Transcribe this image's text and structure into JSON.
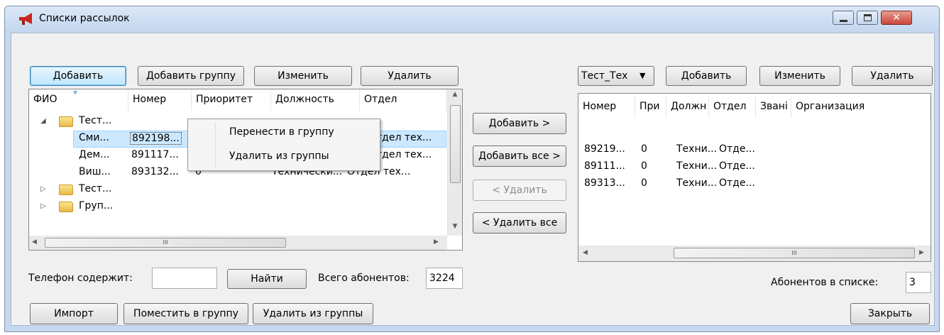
{
  "window": {
    "title": "Списки рассылок"
  },
  "left": {
    "buttons": {
      "add": "Добавить",
      "add_group": "Добавить группу",
      "edit": "Изменить",
      "delete": "Удалить"
    },
    "columns": [
      "ФИО",
      "Номер",
      "Приоритет",
      "Должность",
      "Отдел"
    ],
    "rows": [
      {
        "name": "Тест...",
        "kind": "group"
      },
      {
        "name": "Сми...",
        "number": "892198...",
        "priority": "",
        "position": "",
        "department": "Отдел тех..."
      },
      {
        "name": "Дем...",
        "number": "891117...",
        "priority": "",
        "position": "",
        "department": "Отдел тех..."
      },
      {
        "name": "Виш...",
        "number": "893132...",
        "priority": "0",
        "position": "Технически...",
        "department": "Отдел тех..."
      },
      {
        "name": "Тест...",
        "kind": "group"
      },
      {
        "name": "Груп...",
        "kind": "group"
      }
    ],
    "scroll_glyph": "III"
  },
  "context_menu": {
    "items": [
      "Перенести в группу",
      "Удалить из группы"
    ]
  },
  "middle": {
    "add": "Добавить >",
    "add_all": "Добавить все >",
    "remove": "< Удалить",
    "remove_all": "< Удалить все"
  },
  "right": {
    "list_select": "Тест_Тех",
    "buttons": {
      "add": "Добавить",
      "edit": "Изменить",
      "delete": "Удалить"
    },
    "columns": [
      "Номер",
      "При",
      "Должн",
      "Отдел",
      "Звані",
      "Организация"
    ],
    "rows": [
      {
        "number": "89219...",
        "priority": "0",
        "position": "Техни...",
        "department": "Отде..."
      },
      {
        "number": "89111...",
        "priority": "0",
        "position": "Техни...",
        "department": "Отде..."
      },
      {
        "number": "89313...",
        "priority": "0",
        "position": "Техни...",
        "department": "Отде..."
      }
    ],
    "scroll_glyph": "III"
  },
  "search": {
    "label": "Телефон содержит:",
    "value": "",
    "find": "Найти",
    "total_label": "Всего абонентов:",
    "total_value": "3224"
  },
  "in_list": {
    "label": "Абонентов в списке:",
    "value": "3"
  },
  "bottom": {
    "import": "Импорт",
    "put_in_group": "Поместить в группу",
    "remove_from_group": "Удалить из группы",
    "close": "Закрыть"
  },
  "colors": {
    "title_bg": "#c7d8ee",
    "selection": "#cce8ff",
    "close_btn": "#c9463d",
    "icon_red": "#c8281e"
  }
}
